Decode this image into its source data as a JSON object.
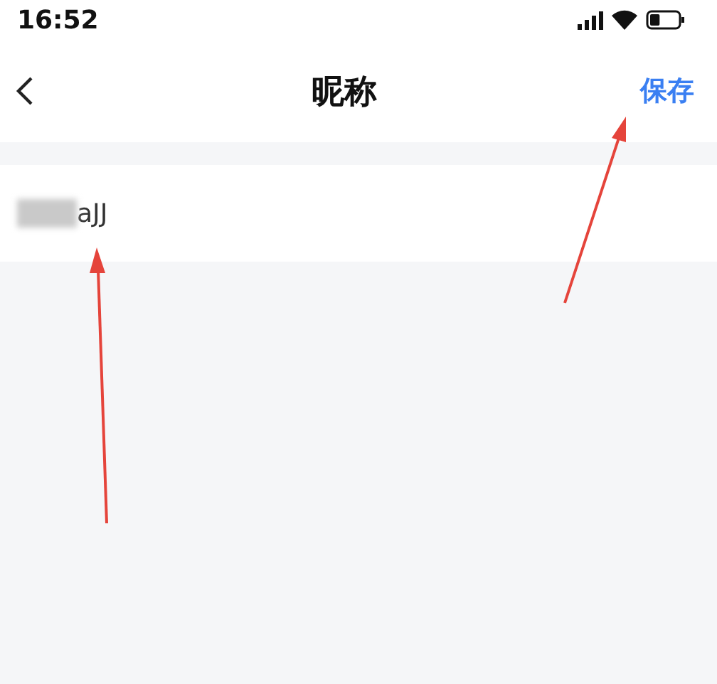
{
  "status_bar": {
    "time": "16:52"
  },
  "nav_bar": {
    "title": "昵称",
    "action": "保存"
  },
  "nickname": {
    "value": "aJJ",
    "redacted": true
  }
}
